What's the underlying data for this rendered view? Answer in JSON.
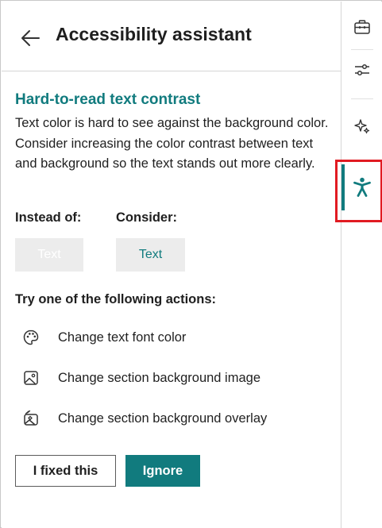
{
  "header": {
    "back_icon": "arrow-left-icon",
    "title": "Accessibility assistant"
  },
  "issue": {
    "title": "Hard-to-read text contrast",
    "description": "Text color is hard to see against the background color. Consider increasing the color contrast between text and background so the text stands out more clearly."
  },
  "comparison": {
    "instead_label": "Instead of:",
    "consider_label": "Consider:",
    "bad_sample": "Text",
    "good_sample": "Text",
    "bad_sample_color": "#ffffff",
    "good_sample_color": "#117b7e",
    "sample_bg": "#ececec"
  },
  "actions": {
    "heading": "Try one of the following actions:",
    "items": [
      {
        "label": "Change text font color",
        "icon": "palette-icon"
      },
      {
        "label": "Change section background image",
        "icon": "image-icon"
      },
      {
        "label": "Change section background overlay",
        "icon": "image-overlay-icon"
      }
    ]
  },
  "buttons": {
    "fixed_label": "I fixed this",
    "ignore_label": "Ignore"
  },
  "toolbar": {
    "items": [
      {
        "icon": "toolbox-icon"
      },
      {
        "icon": "sliders-icon"
      },
      {
        "icon": "sparkle-icon"
      },
      {
        "icon": "accessibility-icon",
        "active": true
      }
    ],
    "active_color": "#117b7e",
    "highlight_color": "#e11b22"
  },
  "colors": {
    "accent": "#117b7e",
    "text": "#1f1f1f"
  }
}
